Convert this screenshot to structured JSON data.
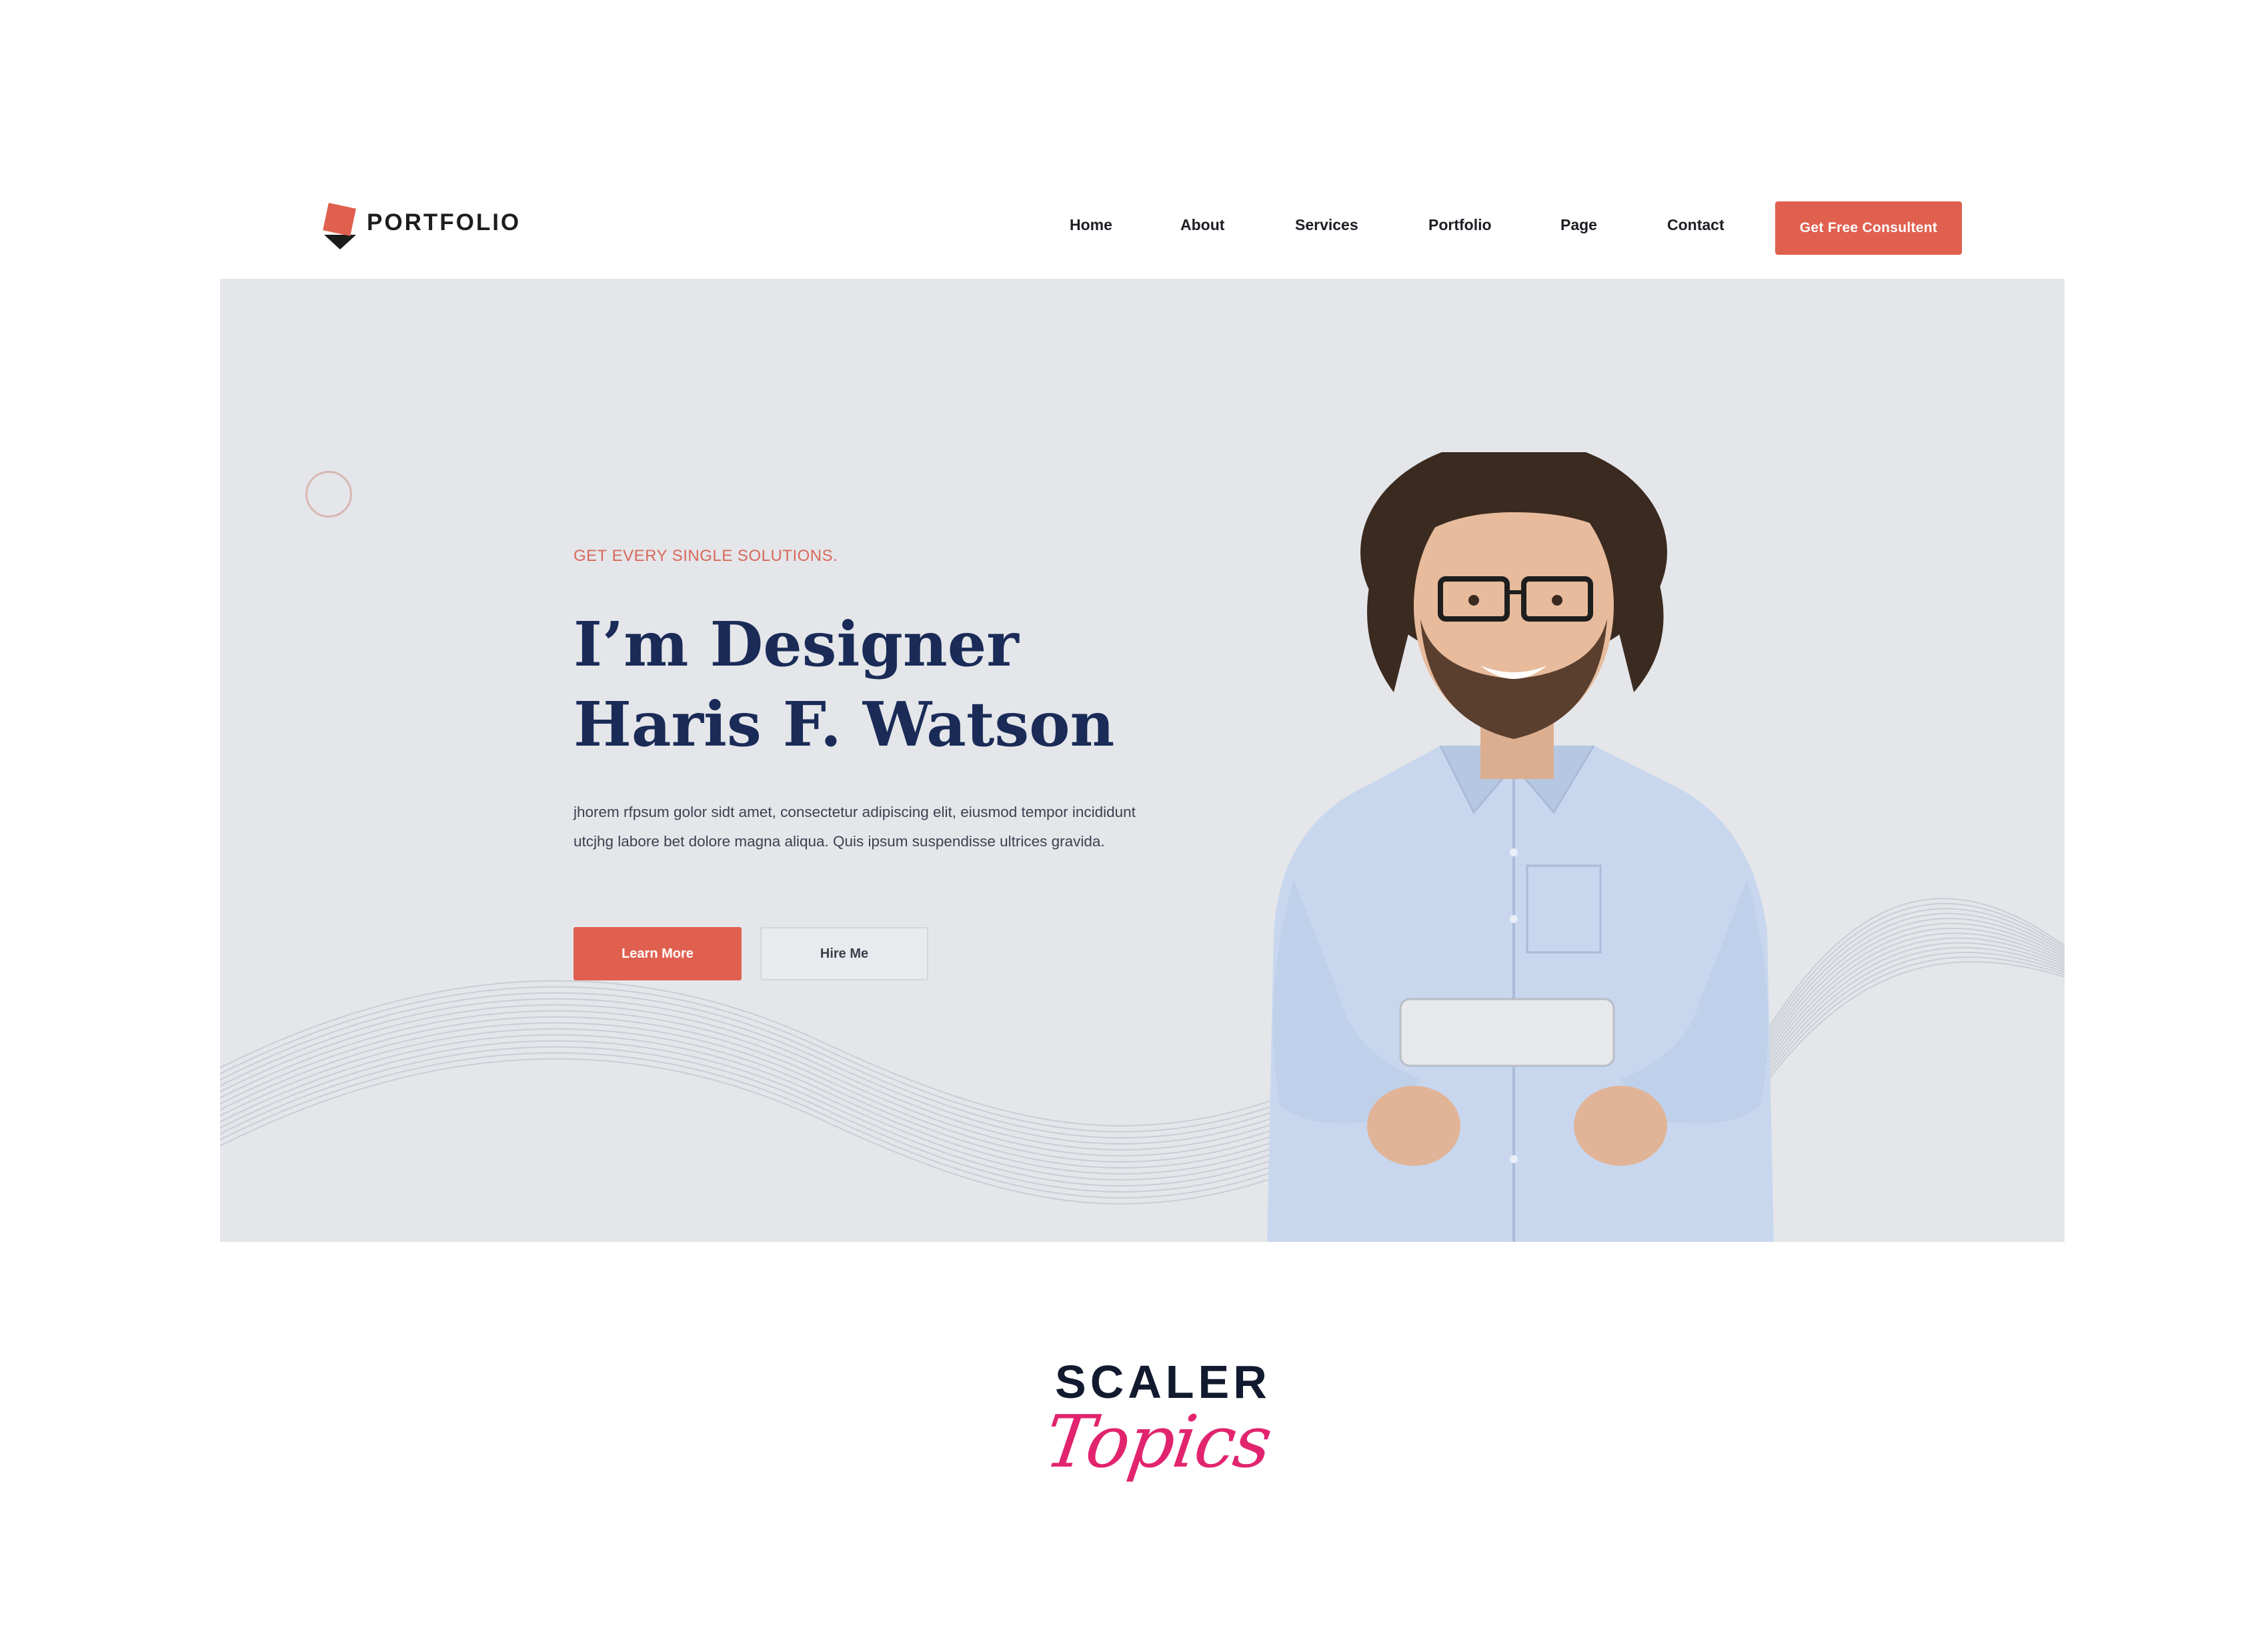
{
  "header": {
    "logo_text": "PORTFOLIO",
    "nav": [
      "Home",
      "About",
      "Services",
      "Portfolio",
      "Page",
      "Contact"
    ],
    "cta_label": "Get Free Consultent"
  },
  "hero": {
    "tagline": "GET EVERY SINGLE SOLUTIONS.",
    "headline_line1": "I’m Designer",
    "headline_line2": "Haris F. Watson",
    "description": "jhorem rfpsum golor sidt amet, consectetur adipiscing elit, eiusmod tempor incididunt utcjhg labore bet dolore magna aliqua. Quis ipsum suspendisse ultrices gravida.",
    "learn_more_label": "Learn More",
    "hire_me_label": "Hire Me"
  },
  "brand": {
    "word": "SCALER",
    "script": "Topics"
  },
  "colors": {
    "accent": "#e0604f",
    "headline": "#1a2b57",
    "hero_bg": "#e4e6ea",
    "brand_pink": "#e2246f"
  }
}
